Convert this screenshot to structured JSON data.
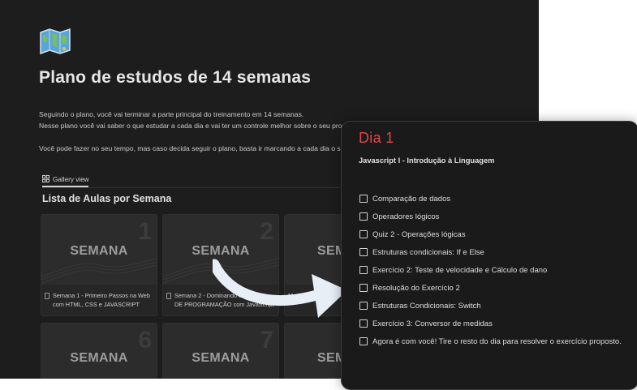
{
  "page": {
    "icon": "world-map-icon",
    "title": "Plano de estudos de 14 semanas",
    "intro_lines": [
      "Seguindo o plano, você vai terminar a parte principal do treinamento em 14 semanas.",
      "Nesse plano você vai saber o que estudar a cada dia e vai ter um controle melhor sobre o seu progresso.",
      "Você pode fazer no seu tempo, mas caso decida seguir o plano, basta ir marcando a cada dia o seu progre"
    ]
  },
  "view_tab": {
    "label": "Gallery view",
    "icon": "grid-icon"
  },
  "gallery": {
    "title": "Lista de Aulas por Semana",
    "cards": [
      {
        "label": "SEMANA",
        "number": "1",
        "caption": "Semana 1 - Primeiro Passos na Web com HTML, CSS e JAVASCRIPT"
      },
      {
        "label": "SEMANA",
        "number": "2",
        "caption": "Semana 2 - Dominando a LÓGICA DE PROGRAMAÇÃO com JavaScript"
      },
      {
        "label": "SEM",
        "number": "",
        "caption": "Manipula"
      },
      {
        "label": "SEMANA",
        "number": "6",
        "caption": ""
      },
      {
        "label": "SEMANA",
        "number": "7",
        "caption": ""
      },
      {
        "label": "SEM",
        "number": "",
        "caption": ""
      }
    ]
  },
  "popup": {
    "title": "Dia 1",
    "subtitle": "Javascript I - Introdução à Linguagem",
    "items": [
      "Comparação de dados",
      "Operadores lógicos",
      "Quiz 2 - Operações lógicas",
      "Estruturas condicionais: If e Else",
      "Exercício 2: Teste de velocidade e Cálculo de dano",
      "Resolução do Exercício 2",
      "Estruturas Condicionais: Switch",
      "Exercício 3: Conversor de medidas",
      "Agora é com você! Tire o resto do dia para resolver o exercício proposto."
    ]
  },
  "colors": {
    "background": "#1d1d1d",
    "popup_title": "#e8434a",
    "arrow": "#e8eef6"
  }
}
